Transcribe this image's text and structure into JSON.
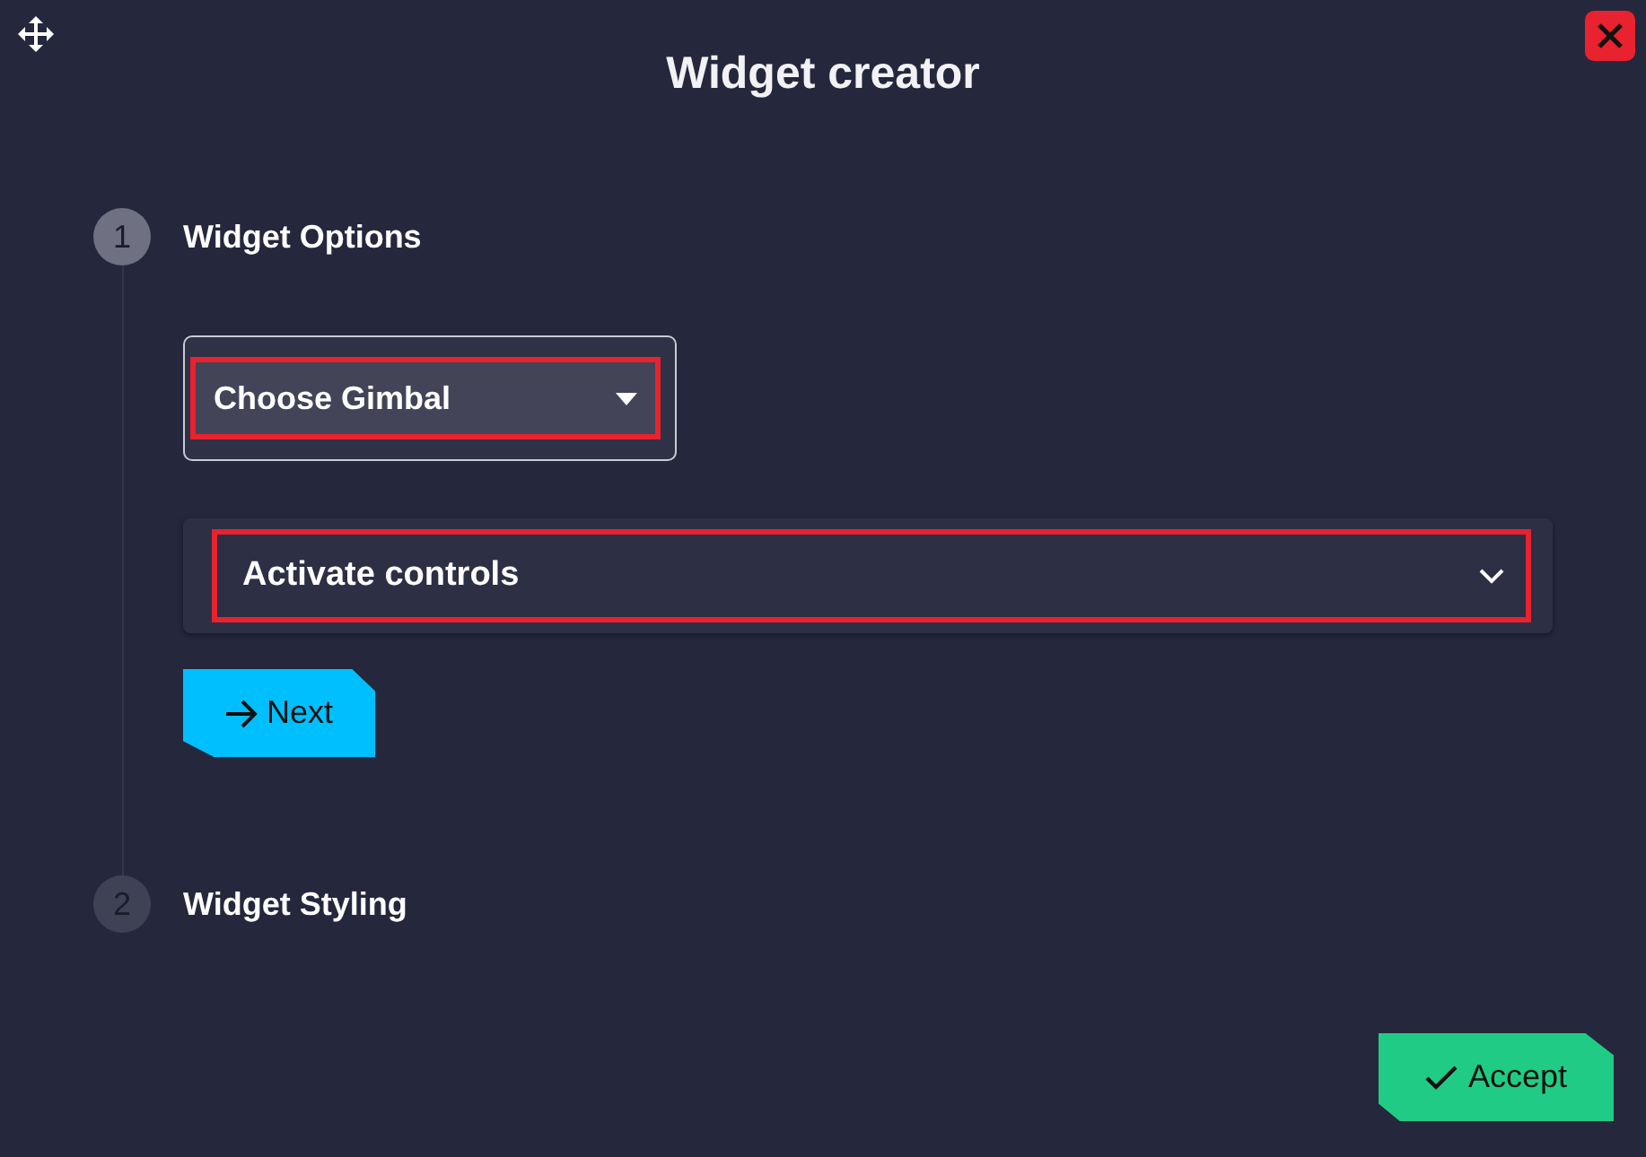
{
  "window": {
    "title": "Widget creator"
  },
  "steps": [
    {
      "number": "1",
      "label": "Widget Options",
      "selected": true
    },
    {
      "number": "2",
      "label": "Widget Styling",
      "selected": false
    }
  ],
  "gimbal_select": {
    "value": "Choose Gimbal",
    "highlighted": true
  },
  "controls_panel": {
    "title": "Activate controls",
    "expanded": false,
    "highlighted": true
  },
  "next_button": {
    "label": "Next"
  },
  "accept_button": {
    "label": "Accept"
  }
}
